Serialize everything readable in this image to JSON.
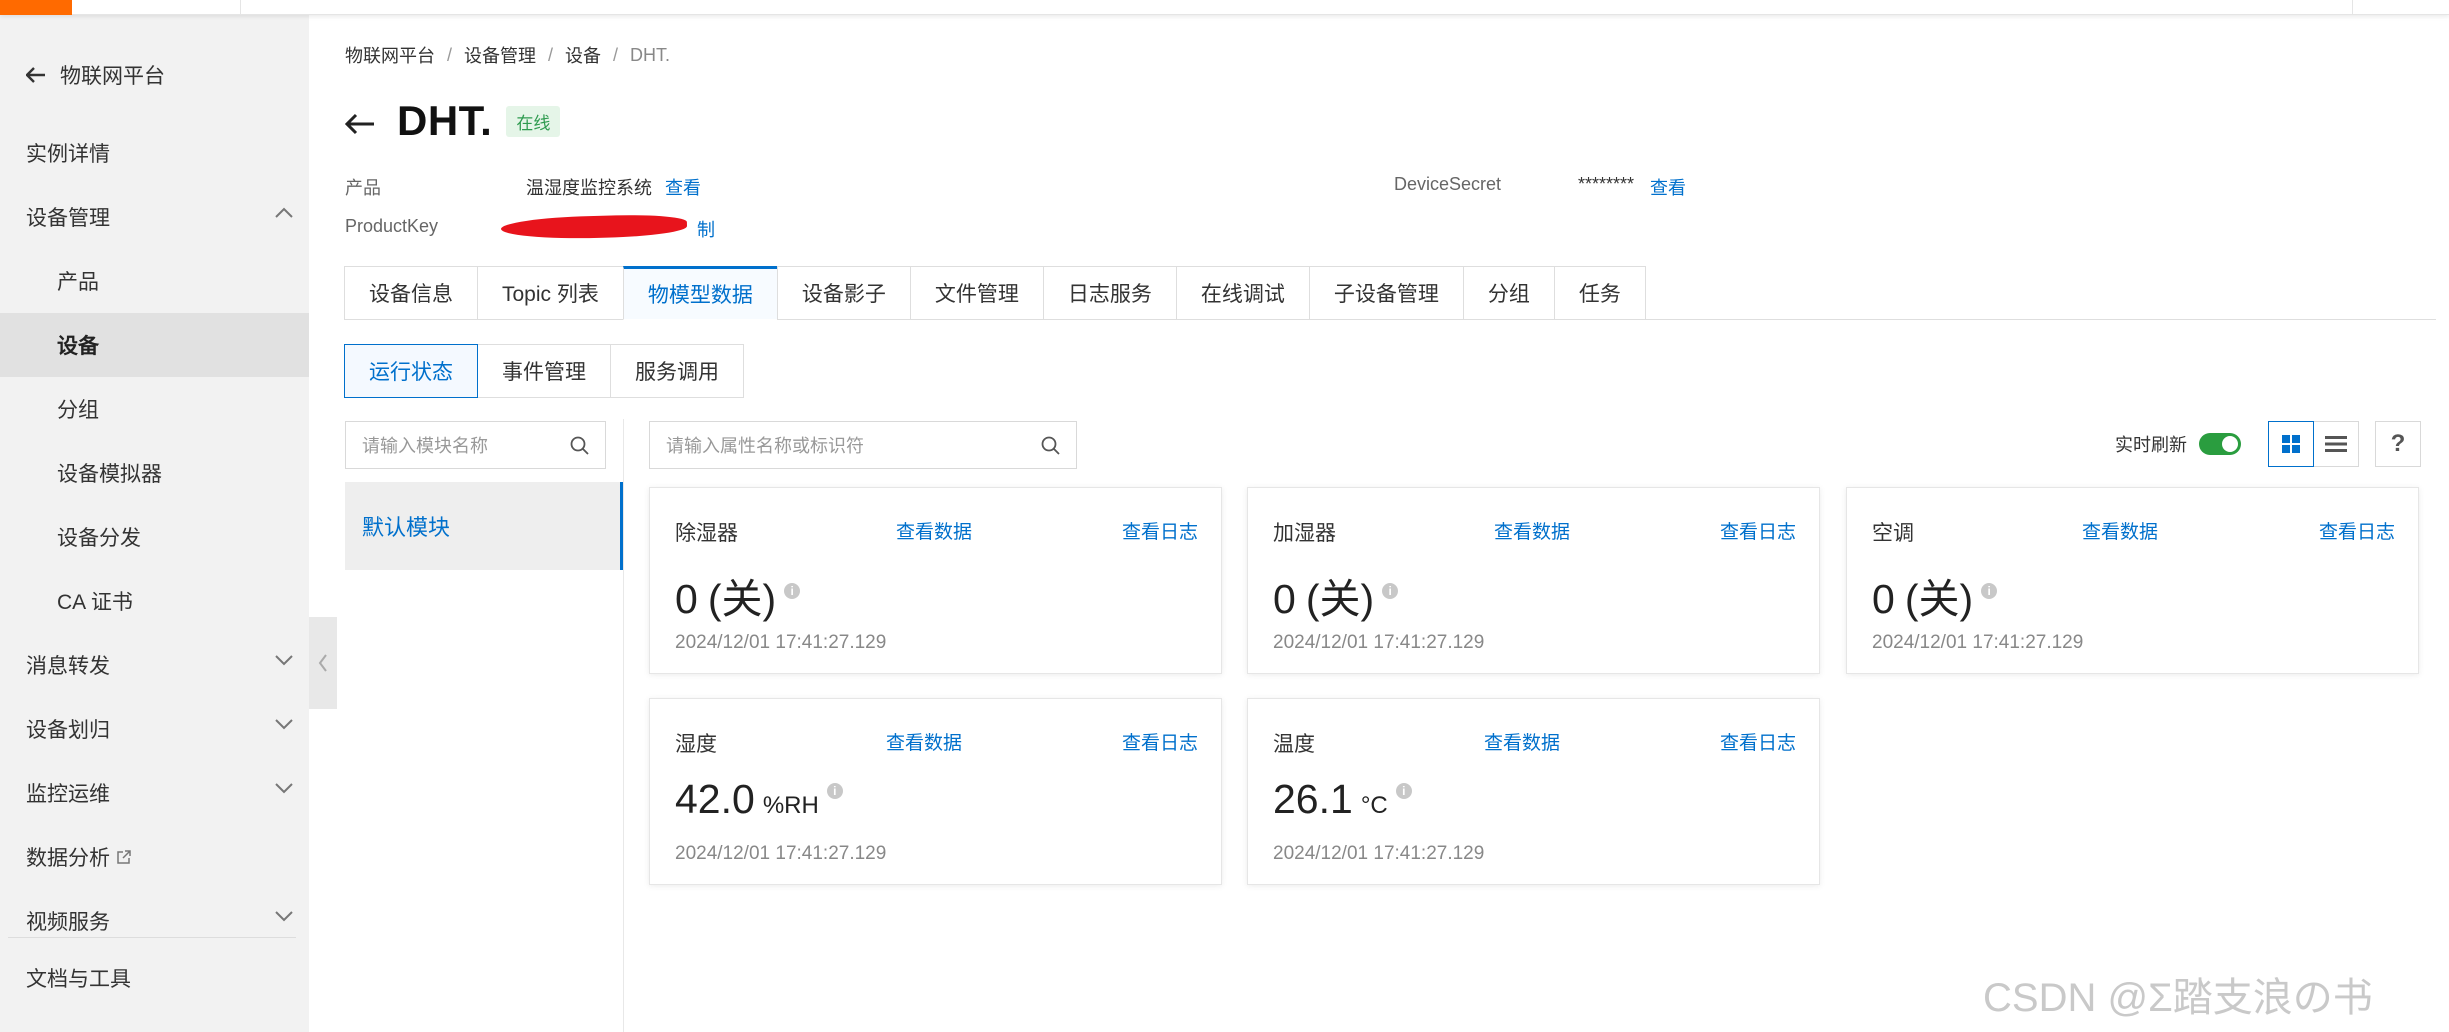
{
  "colors": {
    "accent": "#0070cc",
    "brand": "#ff6a00",
    "online_bg": "#e5f5e8",
    "online_text": "#2e9b4f",
    "switch_on": "#2a9d3f"
  },
  "sidebar": {
    "back_label": "物联网平台",
    "items": [
      {
        "label": "实例详情"
      },
      {
        "label": "设备管理"
      },
      {
        "label": "产品"
      },
      {
        "label": "设备"
      },
      {
        "label": "分组"
      },
      {
        "label": "设备模拟器"
      },
      {
        "label": "设备分发"
      },
      {
        "label": "CA 证书"
      },
      {
        "label": "消息转发"
      },
      {
        "label": "设备划归"
      },
      {
        "label": "监控运维"
      },
      {
        "label": "数据分析"
      },
      {
        "label": "视频服务"
      },
      {
        "label": "文档与工具"
      }
    ]
  },
  "breadcrumb": [
    "物联网平台",
    "设备管理",
    "设备",
    "DHT."
  ],
  "device": {
    "name": "DHT.",
    "status": "在线",
    "product_label": "产品",
    "product_value": "温湿度监控系统",
    "product_link": "查看",
    "productkey_label": "ProductKey",
    "productkey_link_tail": "制",
    "secret_label": "DeviceSecret",
    "secret_value": "********",
    "secret_link": "查看"
  },
  "tabs": [
    "设备信息",
    "Topic 列表",
    "物模型数据",
    "设备影子",
    "文件管理",
    "日志服务",
    "在线调试",
    "子设备管理",
    "分组",
    "任务"
  ],
  "active_tab": "物模型数据",
  "subtabs": [
    "运行状态",
    "事件管理",
    "服务调用"
  ],
  "module_search_placeholder": "请输入模块名称",
  "property_search_placeholder": "请输入属性名称或标识符",
  "module": "默认模块",
  "realtime_label": "实时刷新",
  "help_symbol": "?",
  "card_links": {
    "view_data": "查看数据",
    "view_log": "查看日志"
  },
  "cards": [
    {
      "name": "除湿器",
      "value": "0",
      "unit": "(关)",
      "timestamp": "2024/12/01 17:41:27.129"
    },
    {
      "name": "加湿器",
      "value": "0",
      "unit": "(关)",
      "timestamp": "2024/12/01 17:41:27.129"
    },
    {
      "name": "空调",
      "value": "0",
      "unit": "(关)",
      "timestamp": "2024/12/01 17:41:27.129"
    },
    {
      "name": "湿度",
      "value": "42.0",
      "unit": "%RH",
      "timestamp": "2024/12/01 17:41:27.129"
    },
    {
      "name": "温度",
      "value": "26.1",
      "unit": "°C",
      "timestamp": "2024/12/01 17:41:27.129"
    }
  ],
  "watermark": "CSDN @Σ踏支浪の书"
}
